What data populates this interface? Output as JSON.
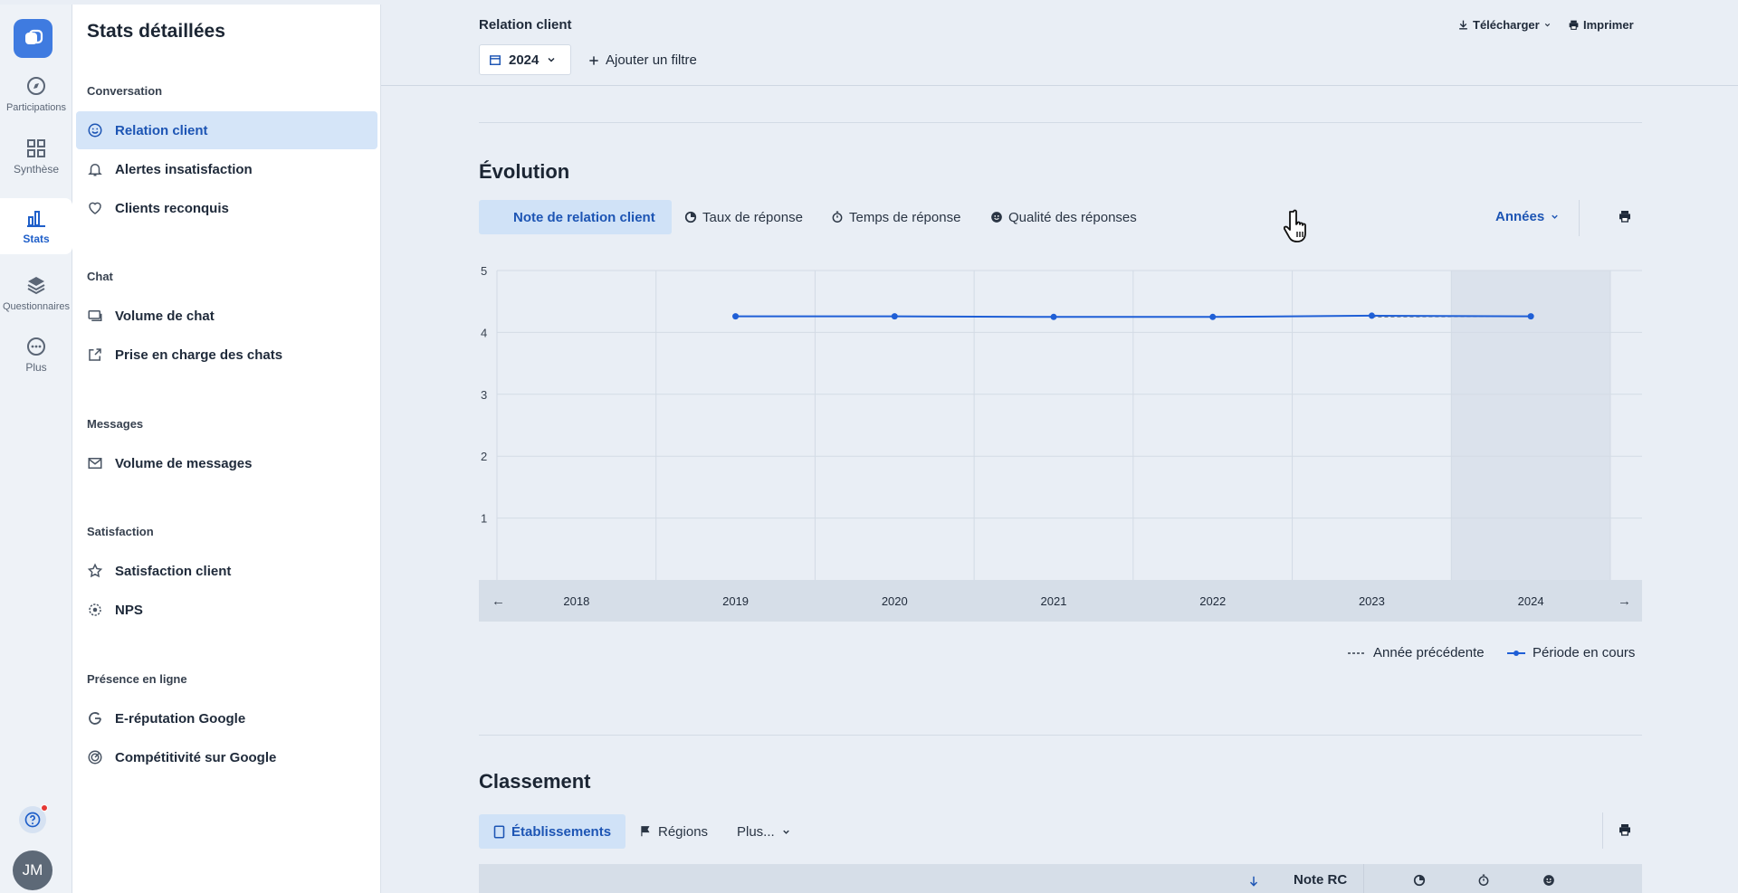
{
  "rail": {
    "items": [
      {
        "label": "Participations",
        "icon": "compass-icon"
      },
      {
        "label": "Synthèse",
        "icon": "grid-icon"
      },
      {
        "label": "Stats",
        "icon": "bar-chart-icon"
      },
      {
        "label": "Questionnaires",
        "icon": "layers-icon"
      },
      {
        "label": "Plus",
        "icon": "more-icon"
      }
    ],
    "avatar_initials": "JM"
  },
  "sidebar": {
    "title": "Stats détaillées",
    "sections": [
      {
        "label": "Conversation",
        "items": [
          "Relation client",
          "Alertes insatisfaction",
          "Clients reconquis"
        ]
      },
      {
        "label": "Chat",
        "items": [
          "Volume de chat",
          "Prise en charge des chats"
        ]
      },
      {
        "label": "Messages",
        "items": [
          "Volume de messages"
        ]
      },
      {
        "label": "Satisfaction",
        "items": [
          "Satisfaction client",
          "NPS"
        ]
      },
      {
        "label": "Présence en ligne",
        "items": [
          "E-réputation Google",
          "Compétitivité sur Google"
        ]
      }
    ]
  },
  "header": {
    "breadcrumb": "Relation client",
    "year": "2024",
    "add_filter": "Ajouter un filtre",
    "download": "Télécharger",
    "print": "Imprimer"
  },
  "evolution": {
    "title": "Évolution",
    "tabs": [
      "Note de relation client",
      "Taux de réponse",
      "Temps de réponse",
      "Qualité des réponses"
    ],
    "period_select": "Années",
    "legend_previous": "Année précédente",
    "legend_current": "Période en cours"
  },
  "chart_data": {
    "type": "line",
    "x": [
      "2018",
      "2019",
      "2020",
      "2021",
      "2022",
      "2023",
      "2024"
    ],
    "series": [
      {
        "name": "Période en cours",
        "values": [
          null,
          4.26,
          4.26,
          4.25,
          4.25,
          4.27,
          4.26
        ]
      },
      {
        "name": "Année précédente",
        "values": [
          null,
          null,
          null,
          null,
          null,
          4.25,
          4.26
        ]
      }
    ],
    "ylim": [
      0,
      5
    ],
    "yticks": [
      1,
      2,
      3,
      4,
      5
    ],
    "highlight": "2024",
    "grid": true,
    "legend": "bottom-right"
  },
  "classement": {
    "title": "Classement",
    "tabs": [
      "Établissements",
      "Régions",
      "Plus..."
    ],
    "column_note": "Note RC"
  },
  "colors": {
    "accent": "#1d55b4",
    "line": "#1f5fd6",
    "active_bg": "#d0e2f7"
  }
}
